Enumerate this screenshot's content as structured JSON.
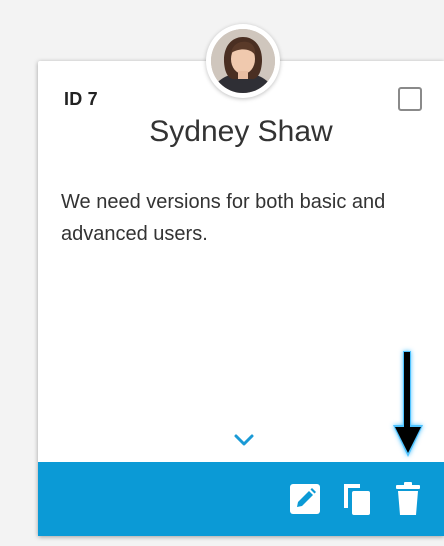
{
  "card": {
    "id_label": "ID 7",
    "name": "Sydney Shaw",
    "message": "We need versions for both basic and advanced users."
  },
  "icons": {
    "avatar": "user-photo",
    "expand": "chevron-down-icon",
    "edit": "pencil-icon",
    "duplicate": "copy-icon",
    "delete": "trash-icon",
    "annotation": "arrow-down-icon"
  },
  "colors": {
    "footer": "#0b9ad6",
    "expand_chevron": "#1a9ad6"
  }
}
